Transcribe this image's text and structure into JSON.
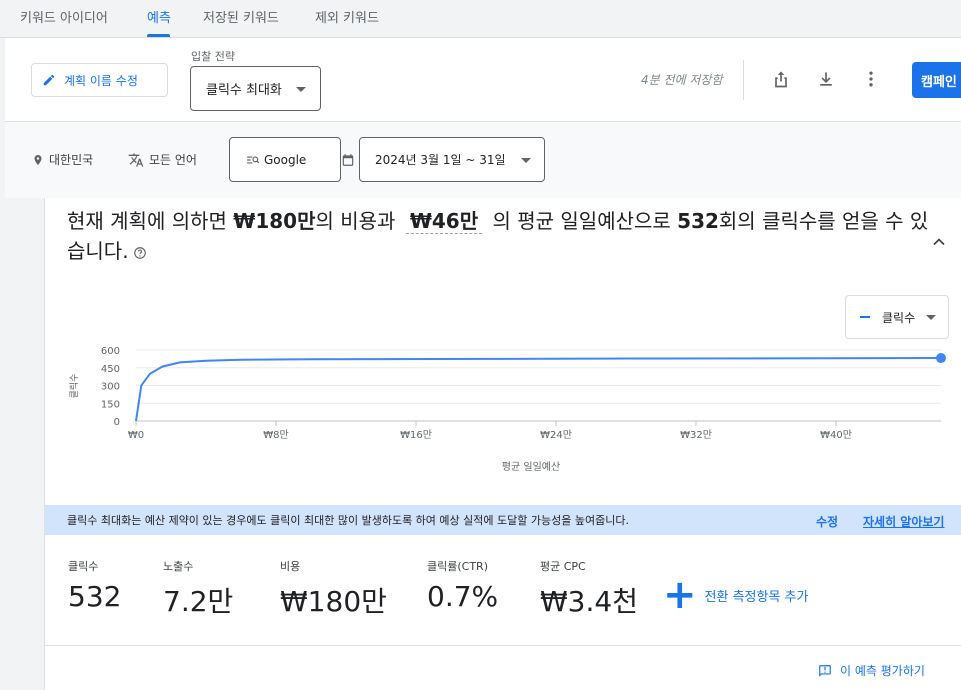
{
  "tabs": [
    {
      "label": "키워드 아이디어",
      "active": false
    },
    {
      "label": "예측",
      "active": true
    },
    {
      "label": "저장된 키워드",
      "active": false
    },
    {
      "label": "제외 키워드",
      "active": false
    }
  ],
  "plan_bar": {
    "rename_label": "계획 이름 수정",
    "bid_strategy_label": "입찰 전략",
    "bid_strategy_value": "클릭수 최대화",
    "saved_status": "4분 전에 저장함",
    "campaign_button": "캠페인"
  },
  "filters": {
    "location": "대한민국",
    "language": "모든 언어",
    "network": "Google",
    "date_range": "2024년 3월 1일 ~ 31일"
  },
  "summary": {
    "part1": "현재 계획에 의하면 ",
    "cost": "₩180만",
    "part2": "의 비용과 ",
    "daily_budget": "₩46만",
    "part3": " 의 평균 일일예산으로 ",
    "clicks": "532",
    "part4": "회의 클릭수를 얻을 수 있습니다."
  },
  "metric_select": "클릭수",
  "chart_data": {
    "type": "line",
    "xlabel": "평균 일일예산",
    "ylabel": "클릭수",
    "ylim": [
      0,
      600
    ],
    "xlim": [
      0,
      46
    ],
    "yticks": [
      "600",
      "450",
      "300",
      "150",
      "0"
    ],
    "xticks": [
      "₩0",
      "₩8만",
      "₩16만",
      "₩24만",
      "₩32만",
      "₩40만"
    ],
    "series": [
      {
        "color": "#4285f4",
        "x": [
          0,
          0.3,
          0.8,
          1.5,
          2.5,
          4,
          6,
          10,
          20,
          30,
          40,
          46
        ],
        "values": [
          0,
          300,
          400,
          460,
          495,
          510,
          518,
          522,
          525,
          528,
          530,
          532
        ]
      }
    ],
    "highlight_point": {
      "x": 46,
      "y": 532
    }
  },
  "banner": {
    "text": "클릭수 최대화는 예산 제약이 있는 경우에도 클릭이 최대한 많이 발생하도록 하여 예상 실적에 도달할 가능성을 높여줍니다.",
    "edit_link": "수정",
    "learn_more_link": "자세히 알아보기"
  },
  "metrics": [
    {
      "label": "클릭수",
      "value": "532"
    },
    {
      "label": "노출수",
      "value": "7.2만"
    },
    {
      "label": "비용",
      "value": "₩180만"
    },
    {
      "label": "클릭률(CTR)",
      "value": "0.7%"
    },
    {
      "label": "평균 CPC",
      "value": "₩3.4천"
    }
  ],
  "add_conversion": "전환 측정항목 추가",
  "feedback": "이 예측 평가하기",
  "colors": {
    "accent": "#1a73e8",
    "line": "#4285f4",
    "banner": "#d2e3fc"
  }
}
